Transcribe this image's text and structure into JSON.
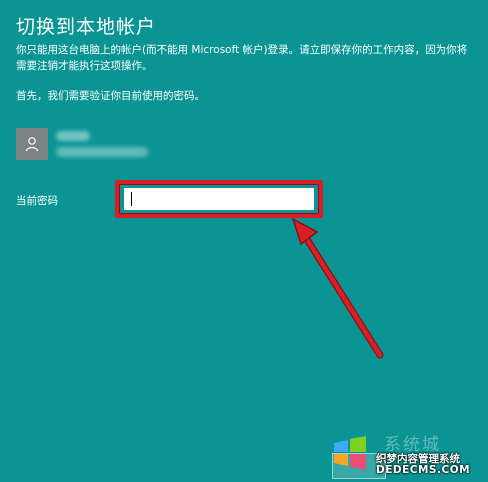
{
  "page": {
    "title": "切换到本地帐户",
    "description": "你只能用这台电脑上的帐户(而不能用 Microsoft 帐户)登录。请立即保存你的工作内容，因为你将需要注销才能执行这项操作。",
    "first_line": "首先，我们需要验证你目前使用的密码。"
  },
  "account": {
    "icon": "user-icon"
  },
  "password": {
    "label": "当前密码",
    "value": ""
  },
  "annotation": {
    "color": "#d81f26"
  },
  "watermark": {
    "site_name": "织梦内容管理系统",
    "domain": "DEDECMS.COM",
    "brand_text": "系统城"
  },
  "colors": {
    "background": "#0a9594",
    "text": "#ffffff"
  }
}
